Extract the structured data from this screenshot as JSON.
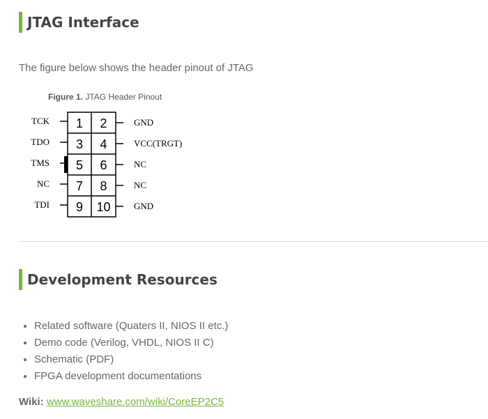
{
  "sections": {
    "jtag": {
      "title": "JTAG Interface",
      "intro": "The figure below shows the header pinout of JTAG",
      "figure_label": "Figure 1.",
      "figure_title": "JTAG Header Pinout",
      "pins": [
        {
          "num": "1",
          "signal": "TCK",
          "side": "left"
        },
        {
          "num": "2",
          "signal": "GND",
          "side": "right"
        },
        {
          "num": "3",
          "signal": "TDO",
          "side": "left"
        },
        {
          "num": "4",
          "signal": "VCC(TRGT)",
          "side": "right"
        },
        {
          "num": "5",
          "signal": "TMS",
          "side": "left"
        },
        {
          "num": "6",
          "signal": "NC",
          "side": "right"
        },
        {
          "num": "7",
          "signal": "NC",
          "side": "left"
        },
        {
          "num": "8",
          "signal": "NC",
          "side": "right"
        },
        {
          "num": "9",
          "signal": "TDI",
          "side": "left"
        },
        {
          "num": "10",
          "signal": "GND",
          "side": "right"
        }
      ]
    },
    "dev": {
      "title": "Development Resources",
      "items": [
        "Related software (Quaters II, NIOS II etc.)",
        "Demo code (Verilog, VHDL, NIOS II C)",
        "Schematic (PDF)",
        "FPGA development documentations"
      ],
      "wiki_label": "Wiki:",
      "wiki_link": "www.waveshare.com/wiki/CoreEP2C5"
    }
  },
  "colors": {
    "accent": "#7cb342",
    "heading": "#444444",
    "text": "#666666"
  }
}
